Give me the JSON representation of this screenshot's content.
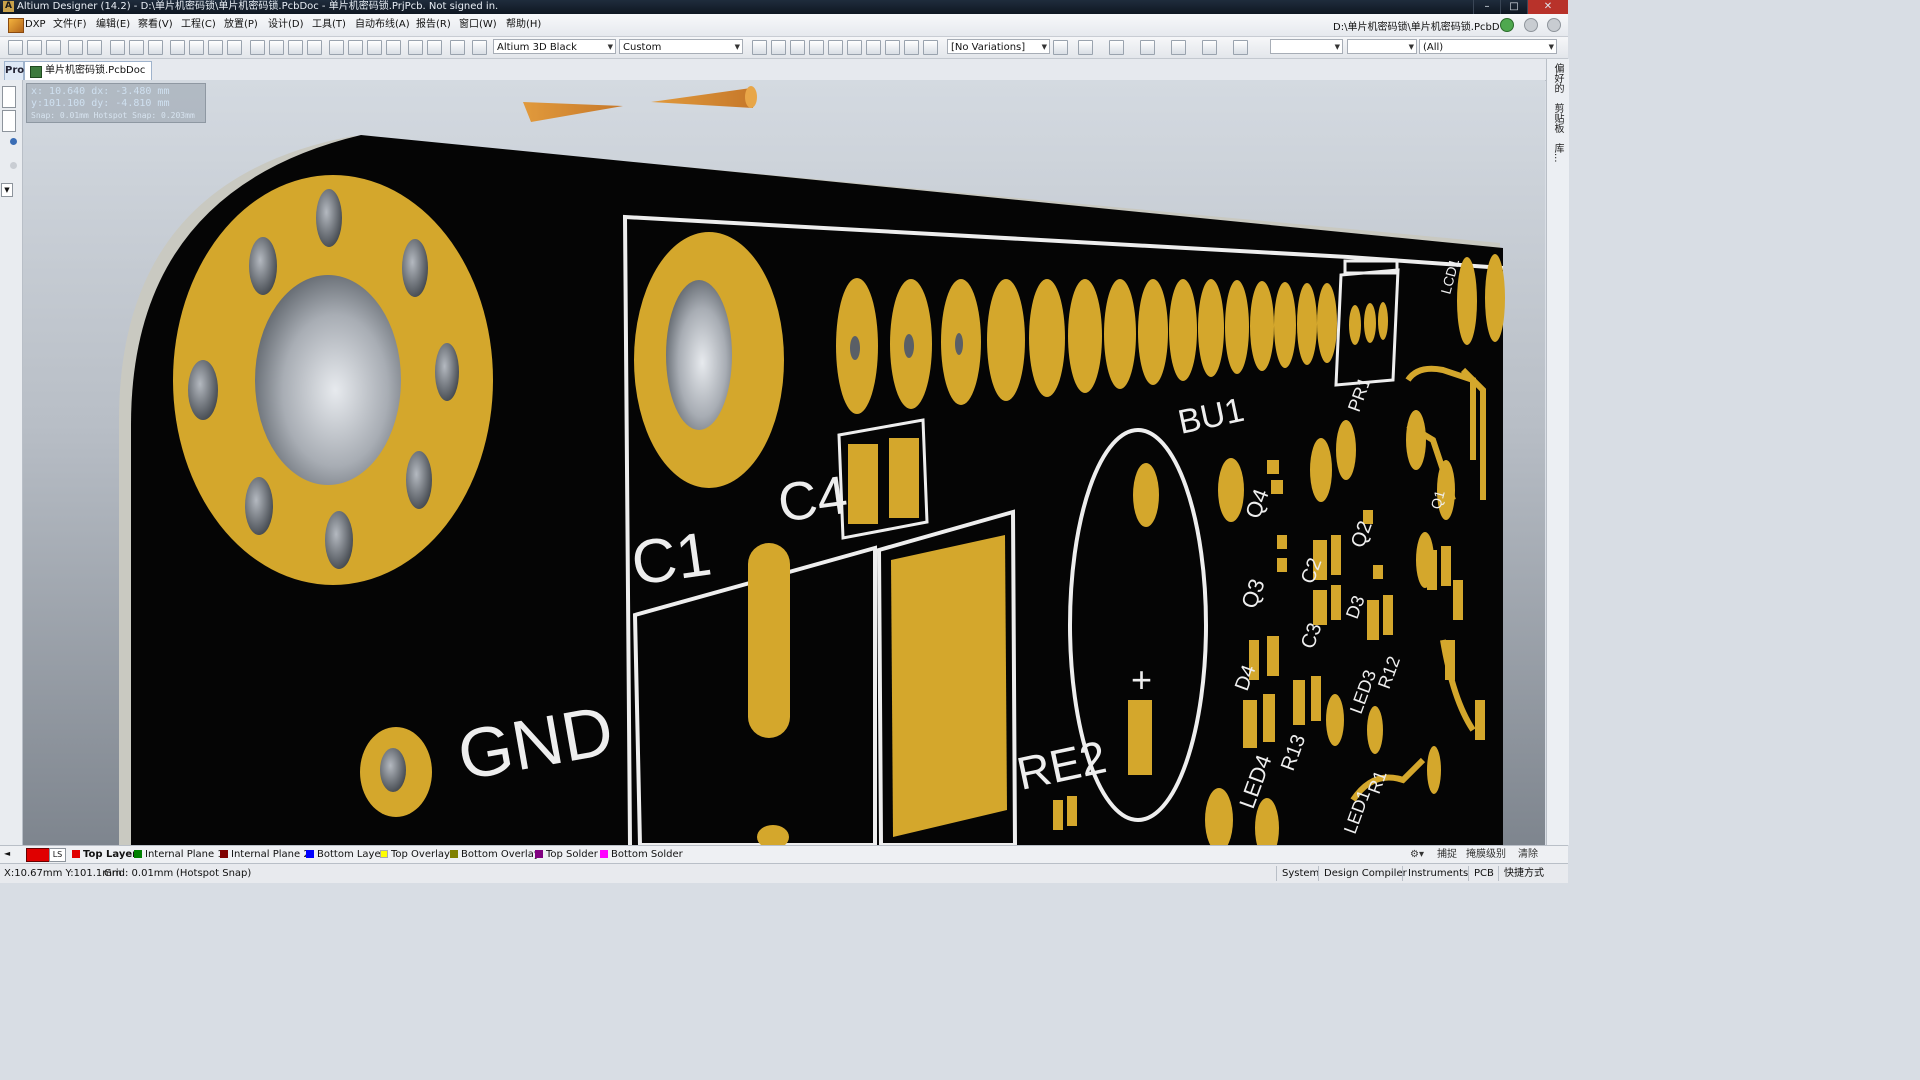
{
  "window": {
    "title": "Altium Designer (14.2) - D:\\单片机密码锁\\单片机密码锁.PcbDoc - 单片机密码锁.PrjPcb. Not signed in."
  },
  "menu": {
    "items": [
      "DXP",
      "文件(F)",
      "编辑(E)",
      "察看(V)",
      "工程(C)",
      "放置(P)",
      "设计(D)",
      "工具(T)",
      "自动布线(A)",
      "报告(R)",
      "窗口(W)",
      "帮助(H)"
    ],
    "path": "D:\\单片机密码锁\\单片机密码锁.PcbD ▾"
  },
  "toolbar": {
    "view_config": "Altium 3D Black",
    "custom_combo": "Custom",
    "variations": "[No Variations]",
    "filter_combo": "(All)"
  },
  "tabs": {
    "panel_tab": "Pro",
    "doc_tab": "单片机密码锁.PcbDoc"
  },
  "coords": {
    "line1": "x: 10.640   dx: -3.480  mm",
    "line2": "y:101.100   dy: -4.810  mm",
    "line3": "Snap: 0.01mm Hotspot Snap: 0.203mm"
  },
  "right_panels": [
    "偏好的",
    "剪贴板",
    "库..."
  ],
  "board": {
    "labels": {
      "c1": "C1",
      "c4": "C4",
      "gnd": "GND",
      "bu1": "BU1",
      "re2": "RE2",
      "pr1": "PR1",
      "lcd1": "LCD1",
      "q1": "Q1",
      "q2": "Q2",
      "q3": "Q3",
      "q4": "Q4",
      "c2": "C2",
      "c3": "C3",
      "d3": "D3",
      "d4": "D4",
      "led3": "LED3",
      "led4": "LED4",
      "r12": "R12",
      "r13": "R13",
      "r1": "R1",
      "led1": "LED1",
      "plus": "+"
    },
    "colors": {
      "background_top": "#cdd4dc",
      "background_bottom": "#8b929b",
      "board": "#050505",
      "edge": "#cfcfc8",
      "copper": "#d4a72c",
      "silkscreen": "#eeeeee"
    }
  },
  "layers": {
    "current_label": "LS",
    "items": [
      {
        "name": "Top Layer",
        "color": "#e00000",
        "active": true
      },
      {
        "name": "Internal Plane 1",
        "color": "#008000",
        "active": false
      },
      {
        "name": "Internal Plane 2",
        "color": "#800000",
        "active": false
      },
      {
        "name": "Bottom Layer",
        "color": "#0000ff",
        "active": false
      },
      {
        "name": "Top Overlay",
        "color": "#ffff00",
        "active": false
      },
      {
        "name": "Bottom Overlay",
        "color": "#808000",
        "active": false
      },
      {
        "name": "Top Solder",
        "color": "#800080",
        "active": false
      },
      {
        "name": "Bottom Solder",
        "color": "#ff00ff",
        "active": false
      }
    ],
    "right_buttons": [
      "捕捉",
      "掩膜级别",
      "清除"
    ]
  },
  "status": {
    "position": "X:10.67mm Y:101.1mm",
    "grid": "Grid: 0.01mm",
    "snap": "(Hotspot Snap)",
    "panels": [
      "System",
      "Design Compiler",
      "Instruments",
      "PCB",
      "快捷方式"
    ]
  }
}
